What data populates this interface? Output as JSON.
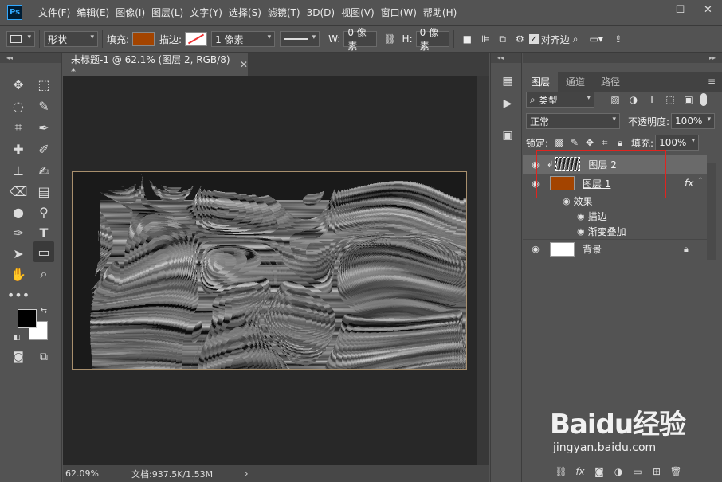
{
  "app": {
    "logo": "Ps"
  },
  "menu": [
    "文件(F)",
    "编辑(E)",
    "图像(I)",
    "图层(L)",
    "文字(Y)",
    "选择(S)",
    "滤镜(T)",
    "3D(D)",
    "视图(V)",
    "窗口(W)",
    "帮助(H)"
  ],
  "window_controls": {
    "minimize": "—",
    "restore": "☐",
    "close": "✕"
  },
  "options": {
    "mode": "形状",
    "fill_label": "填充:",
    "fill_color": "#a34400",
    "stroke_label": "描边:",
    "stroke_width": "1 像素",
    "w_label": "W:",
    "w_value": "0 像素",
    "h_label": "H:",
    "h_value": "0 像素",
    "align_edges": "对齐边"
  },
  "document": {
    "tab_title": "未标题-1 @ 62.1% (图层 2, RGB/8) *",
    "zoom": "62.09%",
    "doc_info": "文档:937.5K/1.53M"
  },
  "colors": {
    "foreground": "#000000",
    "background": "#ffffff"
  },
  "panel": {
    "tabs": [
      "图层",
      "通道",
      "路径"
    ],
    "filter_kind": "类型",
    "blend_mode": "正常",
    "opacity_label": "不透明度:",
    "opacity_value": "100%",
    "lock_label": "锁定:",
    "fill_label": "填充:",
    "fill_value": "100%"
  },
  "layers": [
    {
      "name": "图层 2",
      "selected": true
    },
    {
      "name": "图层 1",
      "fx": "fx",
      "effects_label": "效果",
      "effects": [
        "描边",
        "渐变叠加"
      ]
    },
    {
      "name": "背景",
      "locked": true
    }
  ],
  "watermark": {
    "brand": "Baidu经验",
    "sub": "jingyan.baidu.com"
  }
}
